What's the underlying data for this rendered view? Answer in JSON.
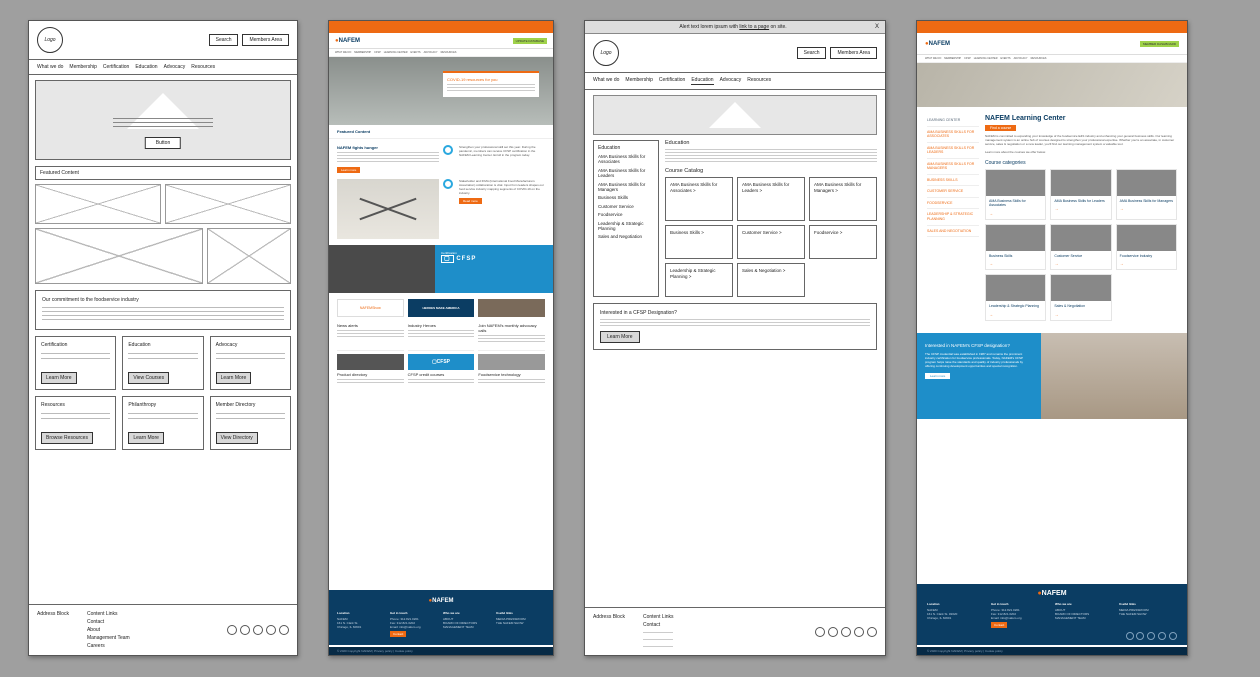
{
  "wf1": {
    "logo": "Logo",
    "search": "Search",
    "members": "Members Area",
    "nav": [
      "What we do",
      "Membership",
      "Certification",
      "Education",
      "Advocacy",
      "Resources"
    ],
    "hero_button": "Button",
    "featured": "Featured Content",
    "commit": "Our commitment to the foodservice industry",
    "cards": [
      {
        "t": "Certification",
        "b": "Learn More"
      },
      {
        "t": "Education",
        "b": "View Courses"
      },
      {
        "t": "Advocacy",
        "b": "Learn More"
      },
      {
        "t": "Resources",
        "b": "Browse Resources"
      },
      {
        "t": "Philanthropy",
        "b": "Learn More"
      },
      {
        "t": "Member Directory",
        "b": "View Directory"
      }
    ],
    "footer": {
      "addr": "Address Block",
      "links_h": "Content Links",
      "links": [
        "Contact",
        "About",
        "Management Team",
        "Careers"
      ]
    }
  },
  "mk2": {
    "brand": "NAFEM",
    "nav": [
      "WHAT WE DO",
      "MEMBERSHIP",
      "CFSP",
      "LEARNING CENTER",
      "EVENTS",
      "ADVOCACY",
      "RESOURCES"
    ],
    "green": "UPDATE DATABASE",
    "hero_title": "COVID-19 resources for you",
    "featured": "Featured Content",
    "fc1": "NAFEM fights hunger",
    "fc2": "Strengthen your professional skill set this year. During the pandemic, members can receive CFSP certification in the NAFEM Learning Center. Enroll in the program today.",
    "fc3": "Stakeholder and IFMA (International Food Manufacturers Association) collaboration is vital. Input from leaders shapes our food service industry mapping segments of COVID-19 on the industry.",
    "cfsp_label": "CFSP",
    "col3": [
      {
        "t": "NAFEMShow"
      },
      {
        "t": "HEROES MAKE AMERICA"
      },
      {
        "t": ""
      }
    ],
    "sc": [
      {
        "t": "News alerts",
        "d": "We offer a curated mix of the most important news..."
      },
      {
        "t": "Industry Heroes",
        "d": "Read the HIT stories that honor our NAFEM..."
      },
      {
        "t": "Join NAFEM's monthly advocacy calls",
        "d": "Learn about advocacy efforts..."
      }
    ],
    "sc2": [
      {
        "t": "Product directory",
        "d": "Find a product in over 600 product categories."
      },
      {
        "t": "CFSP credit courses",
        "d": "Elevate your career. Take the CFSP test."
      },
      {
        "t": "Foodservice technology",
        "d": "Strengthen manufacturing operations, including ideas for foodservice technology."
      }
    ],
    "footer": {
      "cols": [
        {
          "h": "Location",
          "l": [
            "NAFEM",
            "161 N. Clark St.",
            "Chicago, IL 60601"
          ]
        },
        {
          "h": "Get in touch",
          "l": [
            "Phone: 312.821.0201",
            "Fax: 312.821.0202",
            "Email: info@nafem.org"
          ]
        },
        {
          "h": "Who we are",
          "l": [
            "ABOUT",
            "BOARD OF DIRECTORS",
            "MANAGEMENT TEAM"
          ]
        },
        {
          "h": "Useful links",
          "l": [
            "MEDIA PRESSROOM",
            "THE NAFEM SHOW"
          ]
        }
      ],
      "copy": "© 2020 Copyright NAFEM | Privacy policy | Cookie policy"
    }
  },
  "wf3": {
    "alert_pre": "Alert text lorem ipsum with ",
    "alert_link": "link to a page",
    "alert_post": " on site.",
    "close": "X",
    "logo": "Logo",
    "search": "Search",
    "members": "Members Area",
    "nav": [
      "What we do",
      "Membership",
      "Certification",
      "Education",
      "Advocacy",
      "Resources"
    ],
    "side_h": "Education",
    "side": [
      "AMA Business Skills for Associates",
      "AMA Business Skills for Leaders",
      "AMA Business Skills for Managers",
      "Business Skills",
      "Customer Service",
      "Foodservice",
      "Leadership & Strategic Planning",
      "Sales and Negotiation"
    ],
    "main_h": "Education",
    "catalog": "Course Catalog",
    "cats": [
      "AMA Business Skills for Associates >",
      "AMA Business Skills for Leaders >",
      "AMA Business Skills for Managers >",
      "Business Skills >",
      "Customer Service >",
      "Foodservice >",
      "Leadership & Strategic Planning >",
      "Sales & Negotiation >"
    ],
    "cfsp_t": "Interested in a CFSP Designation?",
    "cfsp_b": "Learn More",
    "footer": {
      "addr": "Address Block",
      "links_h": "Content Links",
      "links": [
        "Contact"
      ]
    }
  },
  "mk4": {
    "brand": "NAFEM",
    "nav": [
      "WHAT WE DO",
      "MEMBERSHIP",
      "CFSP",
      "LEARNING CENTER",
      "EVENTS",
      "ADVOCACY",
      "RESOURCES"
    ],
    "green": "MEMBER DASHBOARD",
    "side": [
      "LEARNING CENTER",
      "AMA BUSINESS SKILLS FOR ASSOCIATES",
      "AMA BUSINESS SKILLS FOR LEADERS",
      "AMA BUSINESS SKILLS FOR MANAGERS",
      "BUSINESS SKILLS",
      "CUSTOMER SERVICE",
      "FOODSERVICE",
      "LEADERSHIP & STRATEGIC PLANNING",
      "SALES AND NEGOTIATION"
    ],
    "title": "NAFEM Learning Center",
    "btn": "Find a course",
    "intro": "NAFEM is committed to expanding your knowledge of the foodservice E&S industry and enhancing your general business skills. Our learning management system is an online hub of courses designed to strengthen your professional expertise. Whether you're an associate, in customer service, sales & negotiation or a new leader, you'll find our learning management system a valuable tool.",
    "intro2": "Learn more about the courses we offer below.",
    "ccat": "Course categories",
    "cats": [
      "AMA Business Skills for Associates",
      "AMA Business Skills for Leaders",
      "AMA Business Skills for Managers",
      "Business Skills",
      "Customer Service",
      "Foodservice Industry",
      "Leadership & Strategic Planning",
      "Sales & Negotiation"
    ],
    "cfsp_t": "Interested in NAFEM's CFSP designation?",
    "cfsp_d": "The CFSP credential was established in 1987 and remains the prominent industry certification for foodservice professionals. Today, NAFEM's CFSP program helps raise the standards and quality of industry professionals by offering continuing development opportunities and special recognition.",
    "cfsp_b": "Learn more",
    "footer": {
      "cols": [
        {
          "h": "Location",
          "l": [
            "NAFEM",
            "161 N. Clark St. #2020",
            "Chicago, IL 60601"
          ]
        },
        {
          "h": "Get in touch",
          "l": [
            "Phone: 312.821.0201",
            "Fax: 312.821.0202",
            "Email: info@nafem.org"
          ]
        },
        {
          "h": "Who we are",
          "l": [
            "ABOUT",
            "BOARD OF DIRECTORS",
            "MANAGEMENT TEAM"
          ]
        },
        {
          "h": "Useful links",
          "l": [
            "MEDIA PRESSROOM",
            "THE NAFEM SHOW"
          ]
        }
      ],
      "copy": "© 2020 Copyright NAFEM | Privacy policy | Cookie policy"
    }
  }
}
